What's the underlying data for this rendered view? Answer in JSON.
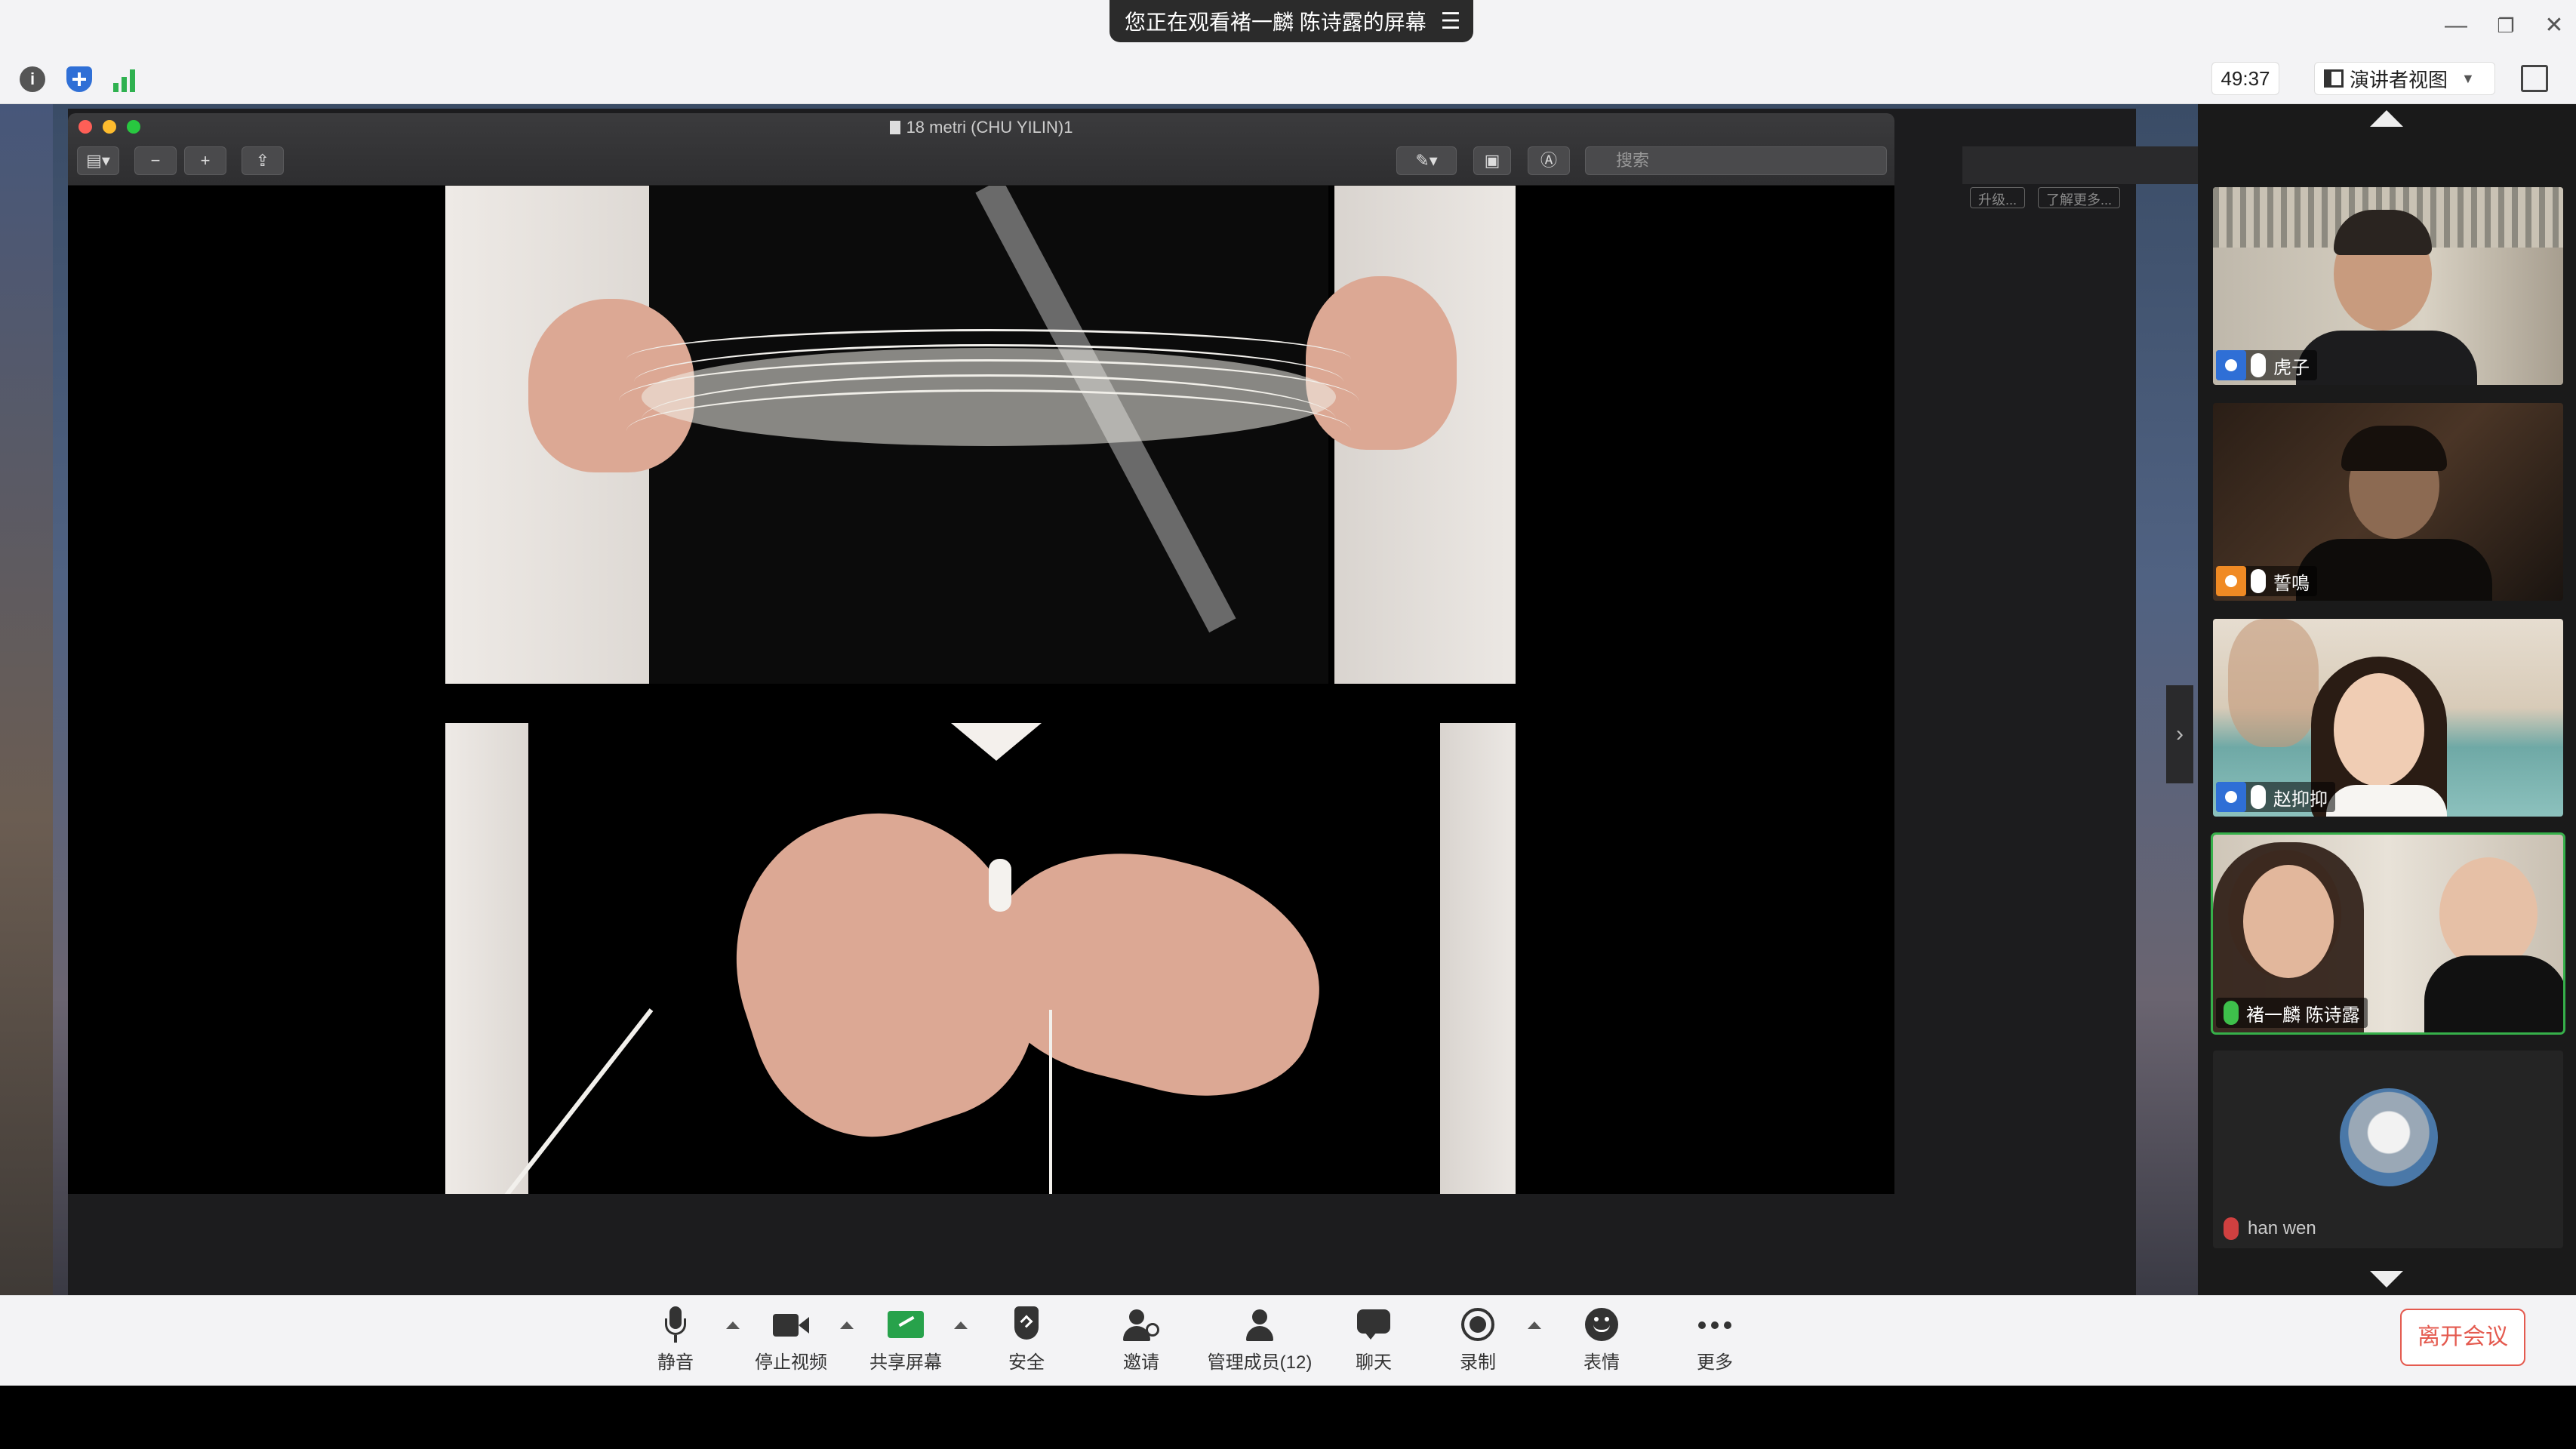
{
  "banner": {
    "sharing_text": "您正在观看褚一麟 陈诗露的屏幕",
    "menu_icon": "list-menu-icon"
  },
  "window_controls": {
    "minimize": "—",
    "restore": "❐",
    "close": "✕"
  },
  "infobar": {
    "timer": "49:37",
    "view_label": "演讲者视图",
    "icons": [
      "info-icon",
      "shield-icon",
      "signal-bars-icon"
    ],
    "security_color": "#2f6fd6",
    "signal_color": "#2fb150"
  },
  "preview": {
    "filename": "18 metri (CHU YILIN)1",
    "search_placeholder": "搜索"
  },
  "background_window": {
    "btn1": "升级...",
    "btn2": "了解更多..."
  },
  "participants": [
    {
      "name": "虎子",
      "user_color": "#2f6fd6",
      "mic": "white"
    },
    {
      "name": "誓鳴",
      "user_color": "#f08a24",
      "mic": "white"
    },
    {
      "name": "赵抑抑",
      "user_color": "#2f6fd6",
      "mic": "white"
    },
    {
      "name": "褚一麟 陈诗露",
      "user_color": "",
      "mic": "green"
    },
    {
      "name": "han wen",
      "user_color": "",
      "mic": "muted"
    }
  ],
  "toolbar": {
    "mute": "静音",
    "stop_video": "停止视频",
    "share_screen": "共享屏幕",
    "security": "安全",
    "invite": "邀请",
    "manage_participants": "管理成员(12)",
    "chat": "聊天",
    "record": "录制",
    "reactions": "表情",
    "more": "更多",
    "leave": "离开会议"
  }
}
